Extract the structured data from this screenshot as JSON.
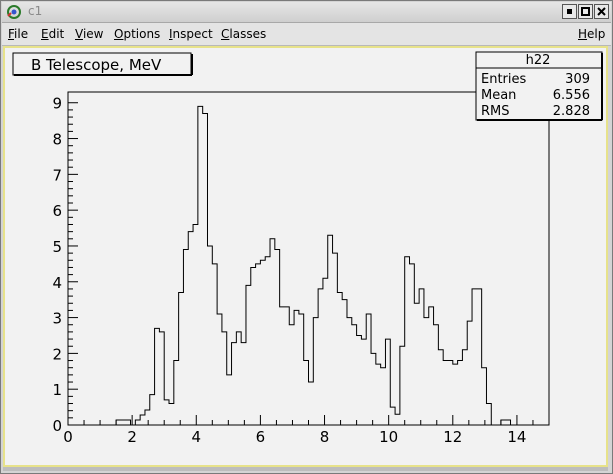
{
  "window": {
    "title": "c1",
    "controls": [
      "minimize-icon",
      "maximize-icon",
      "close-icon"
    ]
  },
  "menubar": {
    "items": [
      {
        "label": "File",
        "mnemonic": "F",
        "rest": "ile"
      },
      {
        "label": "Edit",
        "mnemonic": "E",
        "rest": "dit"
      },
      {
        "label": "View",
        "mnemonic": "V",
        "rest": "iew"
      },
      {
        "label": "Options",
        "mnemonic": "O",
        "rest": "ptions"
      },
      {
        "label": "Inspect",
        "mnemonic": "I",
        "rest": "nspect"
      },
      {
        "label": "Classes",
        "mnemonic": "C",
        "rest": "lasses"
      },
      {
        "label": "Help",
        "mnemonic": "H",
        "rest": "elp"
      }
    ]
  },
  "colors": {
    "canvas_bg": "#f2f2f2",
    "canvas_border": "#e7e28a",
    "line": "#000000"
  },
  "chart_data": {
    "type": "bar",
    "title": "B Telescope, MeV",
    "xlabel": "",
    "ylabel": "",
    "xlim": [
      0,
      15
    ],
    "ylim": [
      0,
      9.3
    ],
    "xticks": [
      "0",
      "2",
      "4",
      "6",
      "8",
      "10",
      "12",
      "14"
    ],
    "yticks": [
      "0",
      "1",
      "2",
      "3",
      "4",
      "5",
      "6",
      "7",
      "8",
      "9"
    ],
    "bin_width": 0.15,
    "x_start": 0,
    "values": [
      0,
      0,
      0,
      0,
      0,
      0,
      0,
      0,
      0,
      0,
      0.14,
      0.14,
      0.14,
      0,
      0.14,
      0.28,
      0.42,
      0.85,
      2.7,
      2.6,
      0.7,
      0.6,
      1.8,
      3.7,
      4.9,
      5.4,
      5.6,
      8.9,
      8.7,
      5.0,
      4.5,
      3.1,
      2.6,
      1.4,
      2.3,
      2.6,
      2.3,
      3.9,
      4.4,
      4.5,
      4.6,
      4.7,
      5.2,
      4.9,
      3.3,
      3.3,
      2.8,
      3.2,
      3.1,
      1.8,
      1.2,
      3.0,
      3.8,
      4.1,
      5.3,
      4.8,
      3.7,
      3.5,
      3.0,
      2.8,
      2.5,
      2.4,
      3.1,
      2.0,
      1.7,
      1.6,
      2.4,
      0.5,
      0.3,
      2.2,
      4.7,
      4.5,
      3.4,
      3.8,
      3.0,
      3.3,
      2.8,
      2.1,
      1.8,
      1.8,
      1.7,
      1.8,
      2.1,
      2.9,
      3.8,
      3.8,
      1.6,
      0.6,
      0,
      0,
      0.14,
      0.14,
      0,
      0
    ],
    "stats": {
      "name": "h22",
      "entries_label": "Entries",
      "entries": "309",
      "mean_label": "Mean",
      "mean": "6.556",
      "rms_label": "RMS",
      "rms": "2.828"
    }
  }
}
